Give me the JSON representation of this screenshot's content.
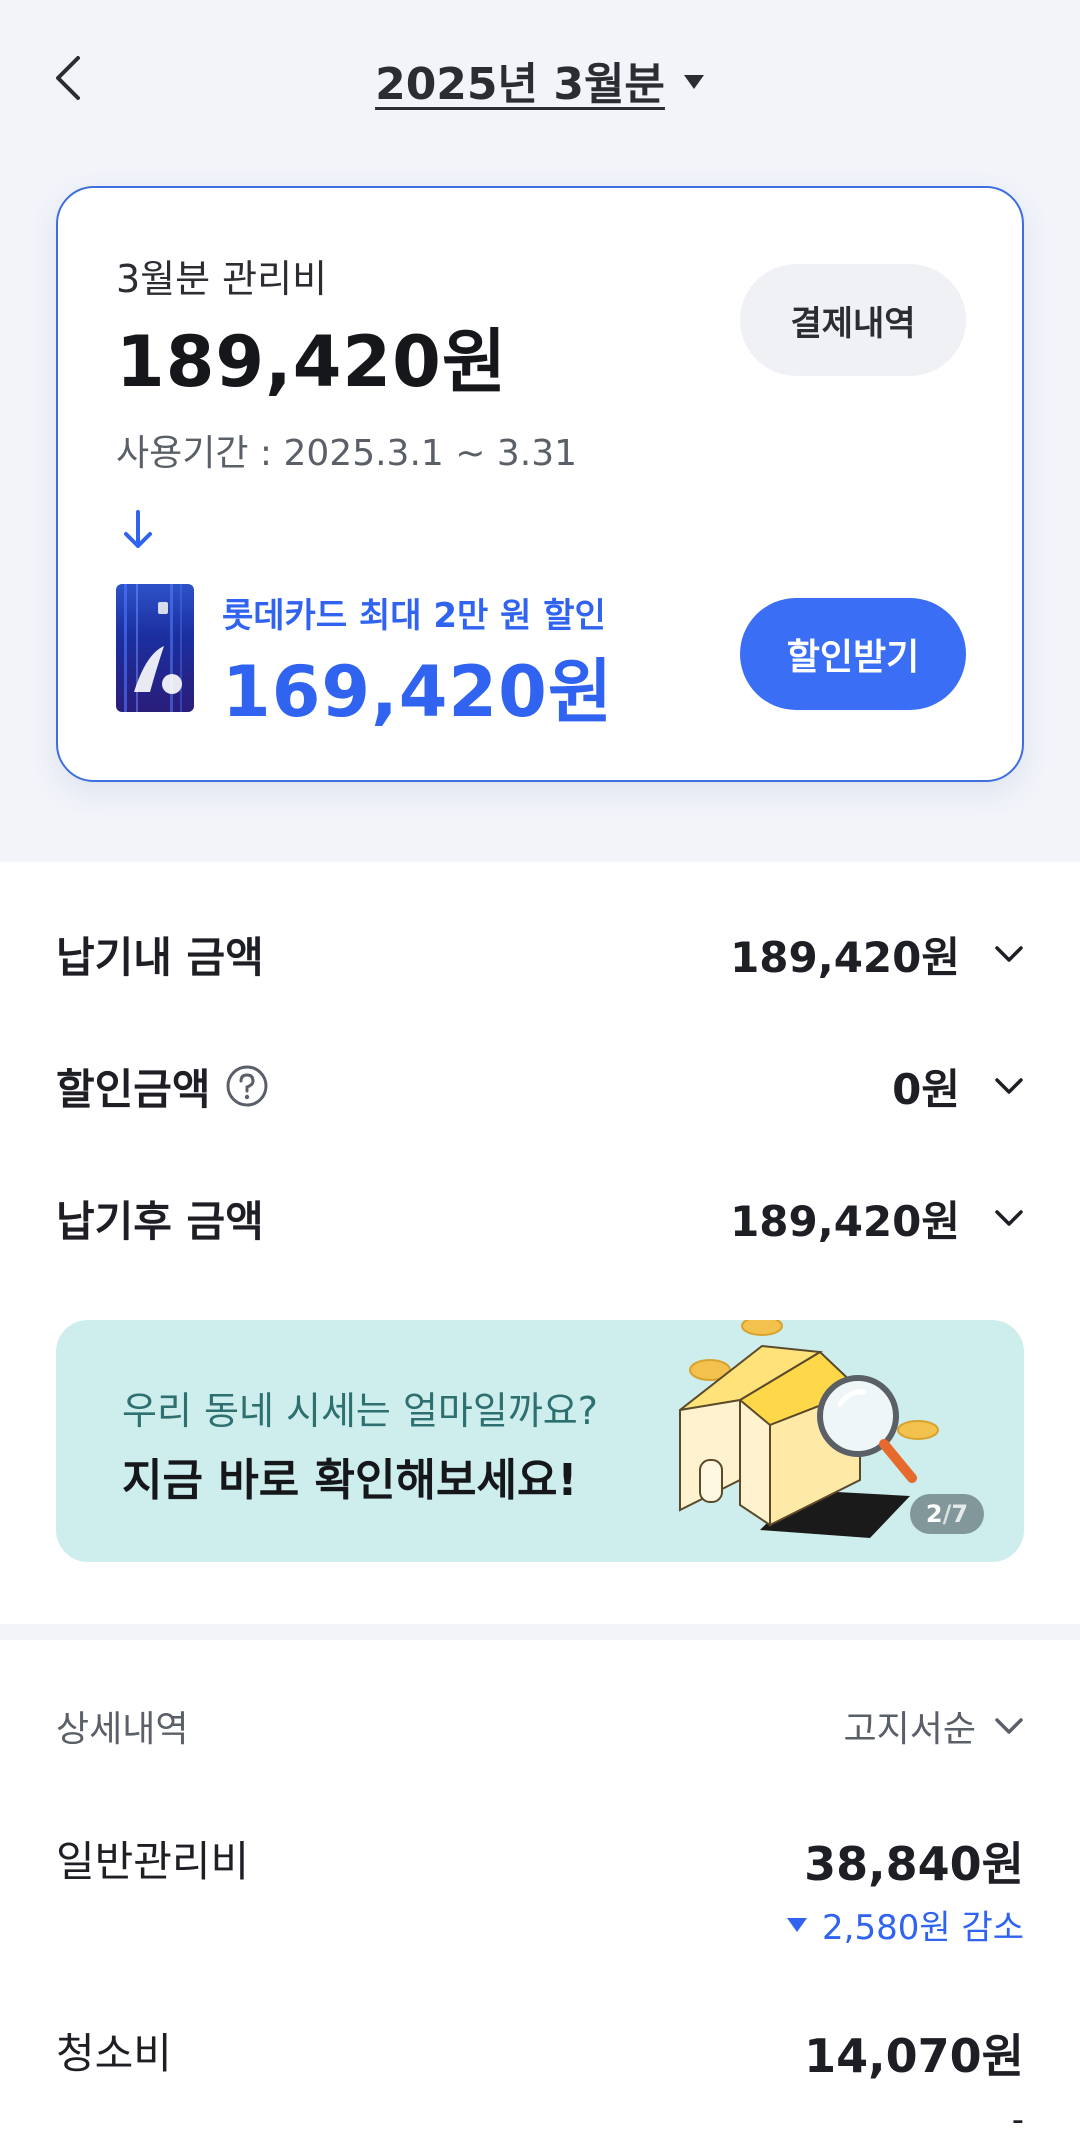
{
  "header": {
    "title": "2025년 3월분",
    "back_icon": "chevron-left-icon",
    "title_caret_icon": "caret-down-icon"
  },
  "summary_card": {
    "month_label": "3월분 관리비",
    "amount": "189,420원",
    "period": "사용기간 : 2025.3.1 ~ 3.31",
    "payment_history_button": "결제내역",
    "promo_text": "롯데카드 최대 2만 원 할인",
    "promo_amount": "169,420원",
    "discount_button": "할인받기",
    "accent_color": "#3a6ff5"
  },
  "amount_rows": [
    {
      "label": "납기내 금액",
      "value": "189,420원"
    },
    {
      "label": "할인금액",
      "value": "0원"
    },
    {
      "label": "납기후 금액",
      "value": "189,420원"
    }
  ],
  "banner": {
    "line1": "우리 동네 시세는 얼마일까요?",
    "line2": "지금 바로 확인해보세요!",
    "pager_current": "2",
    "pager_sep": "/",
    "pager_total": "7"
  },
  "details": {
    "title": "상세내역",
    "sort_label": "고지서순",
    "items": [
      {
        "name": "일반관리비",
        "amount": "38,840원",
        "change": "2,580원 감소"
      },
      {
        "name": "청소비",
        "amount": "14,070원",
        "change": "-"
      }
    ]
  }
}
